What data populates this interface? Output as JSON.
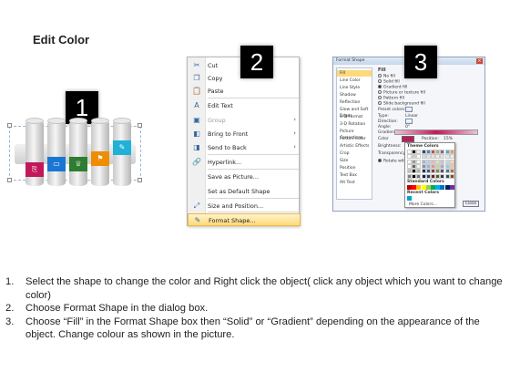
{
  "heading": "Edit Color",
  "badges": [
    "1",
    "2",
    "3"
  ],
  "panel1": {
    "band_colors": [
      "#c2185b",
      "#1976d2",
      "#2e7d32",
      "#ef8c00",
      "#1fb1d6"
    ],
    "band_icons": [
      "chart-icon",
      "monitor-icon",
      "trophy-icon",
      "flag-icon",
      "doc-icon"
    ]
  },
  "context_menu": {
    "items": [
      {
        "label": "Cut",
        "icon": "scissors-icon",
        "glyph": "✂",
        "arrow": false,
        "disabled": false
      },
      {
        "label": "Copy",
        "icon": "copy-icon",
        "glyph": "❐",
        "arrow": false,
        "disabled": false
      },
      {
        "label": "Paste",
        "icon": "paste-icon",
        "glyph": "📋",
        "arrow": false,
        "disabled": false
      },
      {
        "label": "Edit Text",
        "icon": "edit-text-icon",
        "glyph": "A",
        "arrow": false,
        "disabled": false
      },
      {
        "label": "Group",
        "icon": "group-icon",
        "glyph": "▣",
        "arrow": true,
        "disabled": true
      },
      {
        "label": "Bring to Front",
        "icon": "bring-front-icon",
        "glyph": "◧",
        "arrow": true,
        "disabled": false
      },
      {
        "label": "Send to Back",
        "icon": "send-back-icon",
        "glyph": "◨",
        "arrow": true,
        "disabled": false
      },
      {
        "label": "Hyperlink...",
        "icon": "hyperlink-icon",
        "glyph": "🔗",
        "arrow": false,
        "disabled": false
      },
      {
        "label": "Save as Picture...",
        "icon": "",
        "glyph": "",
        "arrow": false,
        "disabled": false
      },
      {
        "label": "Set as Default Shape",
        "icon": "",
        "glyph": "",
        "arrow": false,
        "disabled": false
      },
      {
        "label": "Size and Position...",
        "icon": "size-icon",
        "glyph": "⤢",
        "arrow": false,
        "disabled": false
      },
      {
        "label": "Format Shape...",
        "icon": "format-shape-icon",
        "glyph": "✎",
        "arrow": false,
        "disabled": false
      }
    ]
  },
  "format_dialog": {
    "title": "Format Shape",
    "nav": [
      "Fill",
      "Line Color",
      "Line Style",
      "Shadow",
      "Reflection",
      "Glow and Soft Edges",
      "3-D Format",
      "3-D Rotation",
      "Picture Corrections",
      "Picture Color",
      "Artistic Effects",
      "Crop",
      "Size",
      "Position",
      "Text Box",
      "Alt Text"
    ],
    "fill_heading": "Fill",
    "fill_options": [
      "No fill",
      "Solid fill",
      "Gradient fill",
      "Picture or texture fill",
      "Pattern fill",
      "Slide background fill"
    ],
    "selected_fill": "Gradient fill",
    "labels": {
      "preset": "Preset colors:",
      "type": "Type:",
      "type_value": "Linear",
      "direction": "Direction:",
      "angle": "Angle:",
      "angle_value": "0°",
      "stops": "Gradient stops",
      "color": "Color",
      "position": "Position:",
      "position_value": "15%",
      "brightness": "Brightness:",
      "transparency": "Transparency:",
      "rotate": "Rotate with shape"
    },
    "palette": {
      "theme_label": "Theme Colors",
      "standard_label": "Standard Colors",
      "recent_label": "Recent Colors",
      "more": "More Colors...",
      "theme_top": [
        "#ffffff",
        "#000000",
        "#eeece1",
        "#1f497d",
        "#4f81bd",
        "#c0504d",
        "#9bbb59",
        "#8064a2",
        "#4bacc6",
        "#f79646"
      ],
      "standard": [
        "#c00000",
        "#ff0000",
        "#ffc000",
        "#ffff00",
        "#92d050",
        "#00b050",
        "#00b0f0",
        "#0070c0",
        "#002060",
        "#7030a0"
      ]
    },
    "close_label": "Close"
  },
  "instructions": [
    {
      "num": "1.",
      "text": "Select the shape to change the color and Right click the object( click any object which you want to change color)"
    },
    {
      "num": "2.",
      "text": "Choose Format Shape in the dialog box."
    },
    {
      "num": "3.",
      "text": "Choose “Fill” in the Format Shape box then “Solid” or “Gradient” depending on the appearance of the object. Change colour as shown in the picture."
    }
  ]
}
